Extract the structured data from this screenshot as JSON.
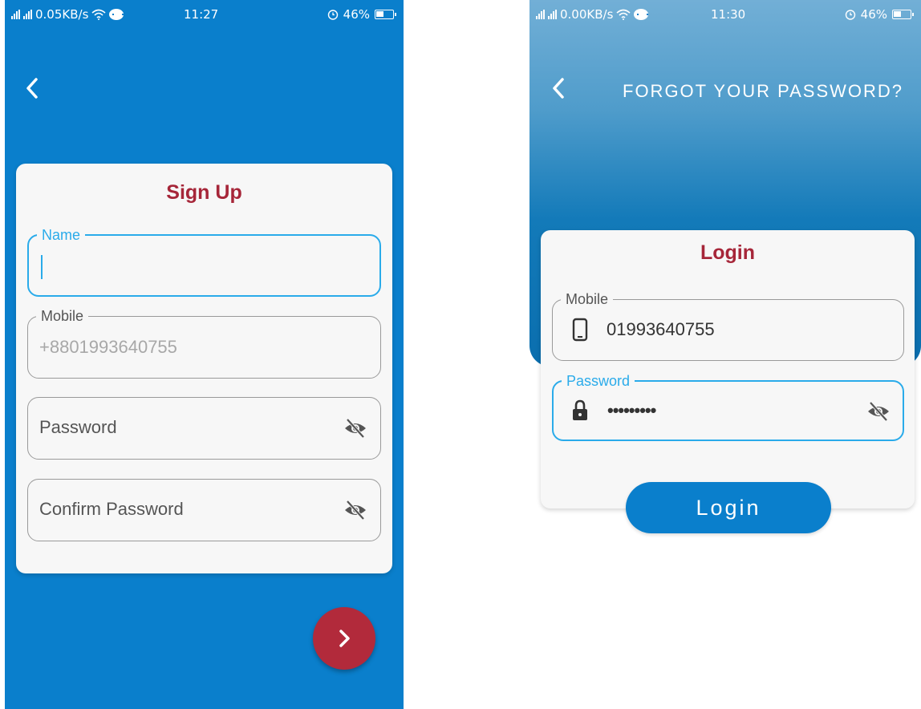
{
  "signup_screen": {
    "status_bar": {
      "network_speed": "0.05KB/s",
      "time": "11:27",
      "battery": "46%"
    },
    "title": "Sign Up",
    "fields": {
      "name": {
        "label": "Name",
        "value": ""
      },
      "mobile": {
        "label": "Mobile",
        "value": "+8801993640755"
      },
      "password": {
        "placeholder": "Password"
      },
      "confirm_password": {
        "placeholder": "Confirm Password"
      }
    },
    "icons": {
      "back": "chevron-left-icon",
      "password_toggle": "eye-off-icon",
      "next": "chevron-right-icon"
    }
  },
  "login_screen": {
    "status_bar": {
      "network_speed": "0.00KB/s",
      "time": "11:30",
      "battery": "46%"
    },
    "forgot_password_label": "FORGOT YOUR PASSWORD?",
    "title": "Login",
    "fields": {
      "mobile": {
        "label": "Mobile",
        "value": "01993640755"
      },
      "password": {
        "label": "Password",
        "value": "•••••••••"
      }
    },
    "login_button_label": "Login",
    "icons": {
      "back": "chevron-left-icon",
      "mobile": "phone-icon",
      "password": "lock-icon",
      "password_toggle": "eye-off-icon"
    }
  },
  "colors": {
    "primary_blue": "#0a7fcc",
    "title_red": "#a62639",
    "fab_red": "#b22a3b",
    "focus_blue": "#2aabea"
  }
}
